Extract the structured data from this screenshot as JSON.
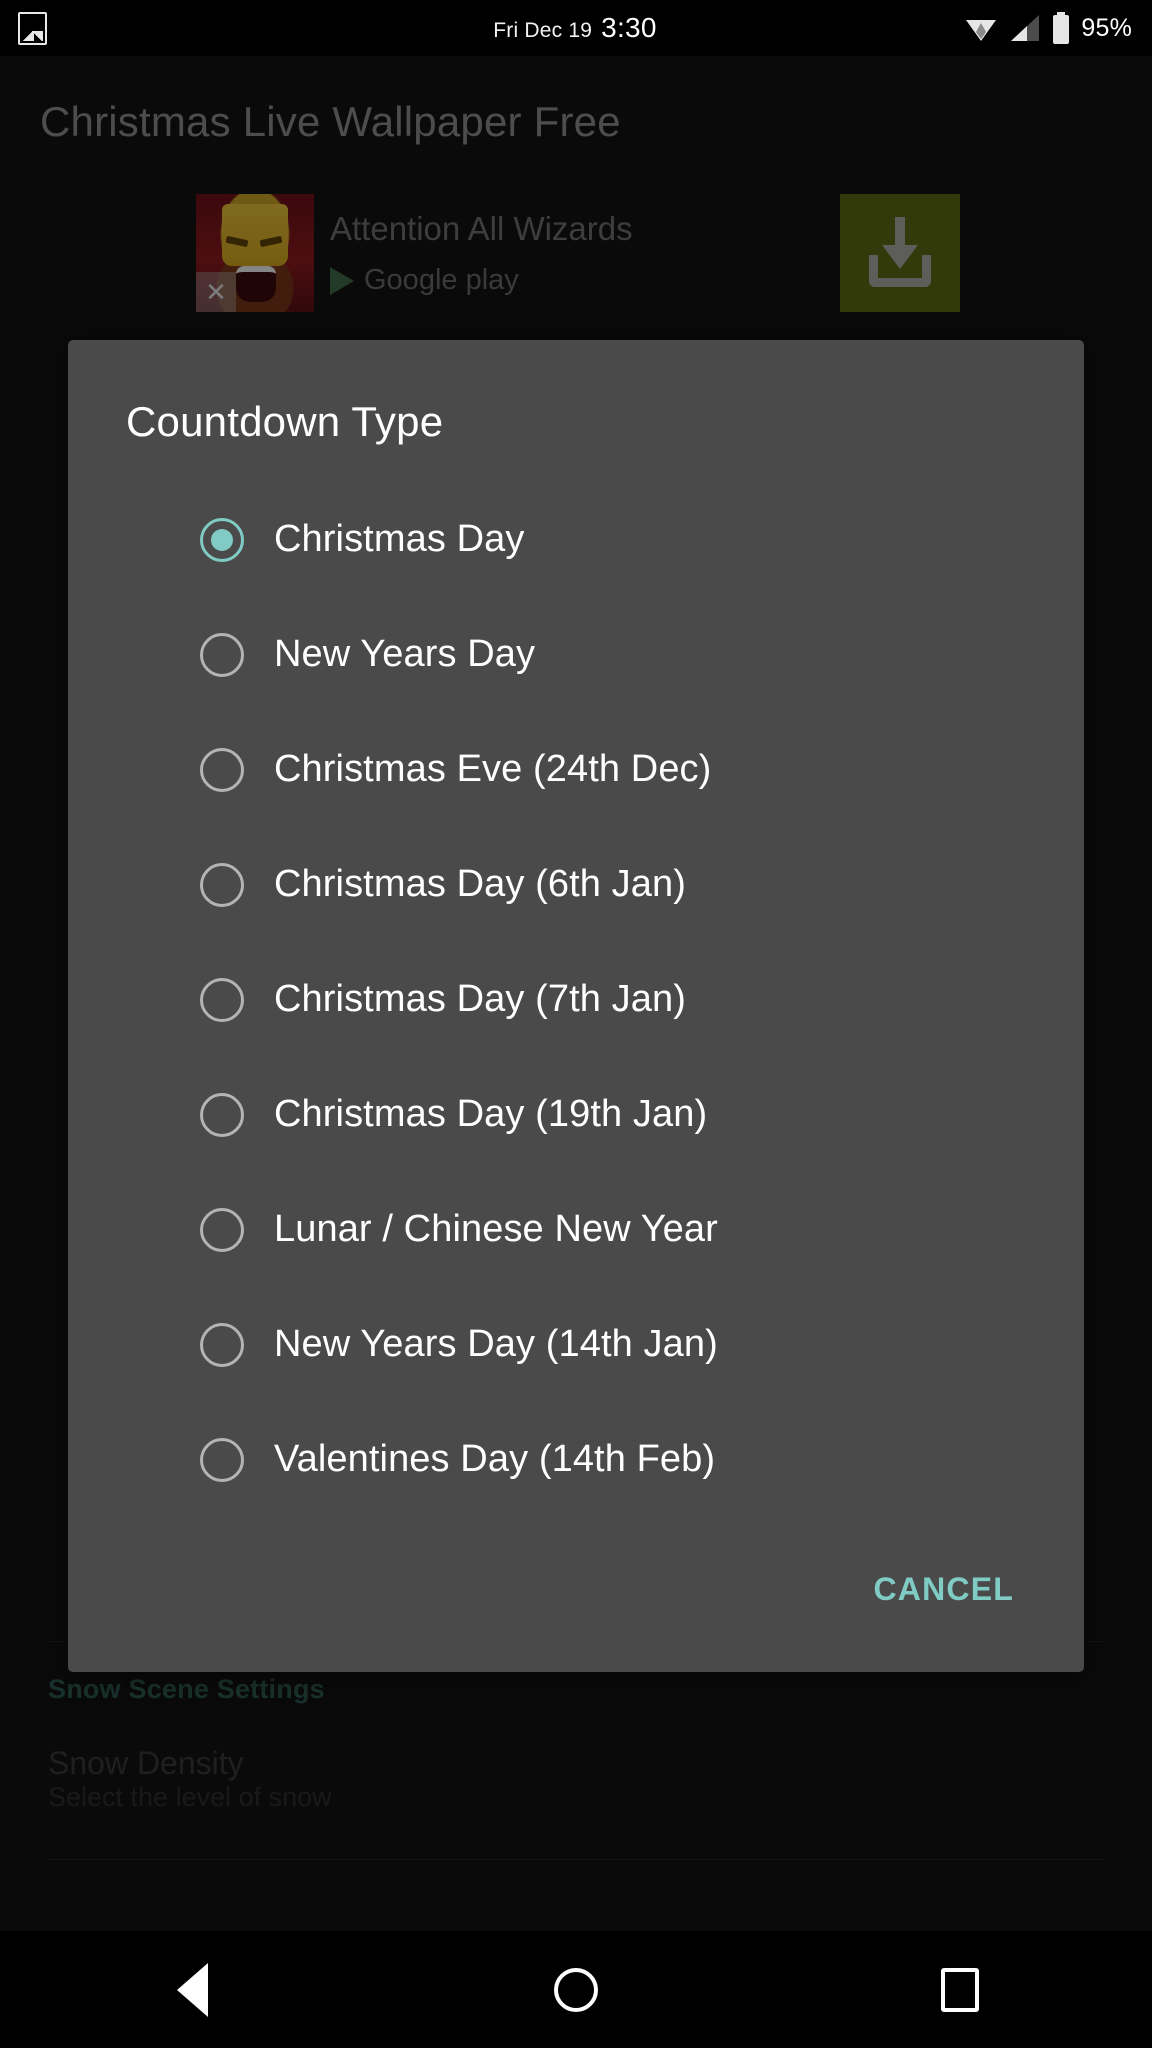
{
  "status_bar": {
    "notification_icon": "image-icon",
    "date": "Fri Dec 19",
    "time": "3:30",
    "wifi_icon": "wifi-icon",
    "signal_icon": "cell-signal-icon",
    "battery_icon": "battery-icon",
    "battery_percent": "95%"
  },
  "app": {
    "title": "Christmas Live Wallpaper Free"
  },
  "ad": {
    "headline": "Attention All Wizards",
    "store_badge": "Google play",
    "close_label": "✕",
    "download_icon": "download-icon"
  },
  "dialog": {
    "title": "Countdown Type",
    "selected_index": 0,
    "options": [
      "Christmas Day",
      "New Years Day",
      "Christmas Eve (24th Dec)",
      "Christmas Day (6th Jan)",
      "Christmas Day (7th Jan)",
      "Christmas Day (19th Jan)",
      "Lunar / Chinese New Year",
      "New Years Day (14th Jan)",
      "Valentines Day (14th Feb)"
    ],
    "cancel_label": "CANCEL",
    "accent_color": "#80cbc4",
    "background_color": "#4a4a4a"
  },
  "background_settings": {
    "section_label": "Snow Scene Settings",
    "item_title": "Snow Density",
    "item_subtitle": "Select the level of snow"
  },
  "nav_bar": {
    "back": "back-icon",
    "home": "home-icon",
    "recents": "recents-icon"
  }
}
